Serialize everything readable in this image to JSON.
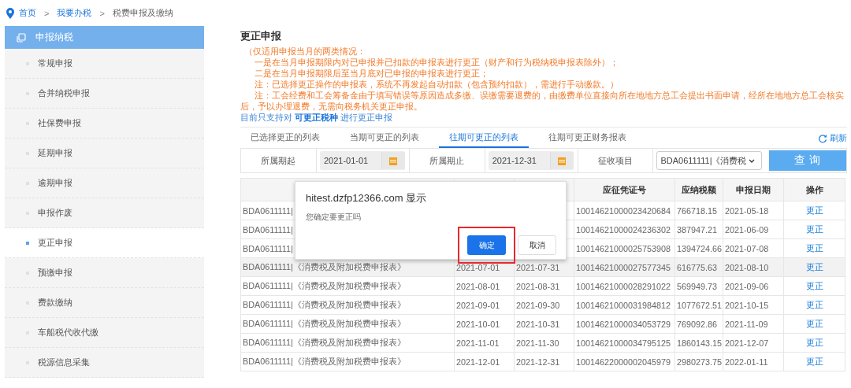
{
  "breadcrumb": {
    "separator": ">",
    "items": [
      {
        "label": "首页",
        "link": true
      },
      {
        "label": "我要办税",
        "link": true
      },
      {
        "label": "税费申报及缴纳",
        "link": false
      }
    ]
  },
  "sidebar": {
    "title": "申报纳税",
    "items": [
      {
        "label": "常规申报",
        "selected": false
      },
      {
        "label": "合并纳税申报",
        "selected": false
      },
      {
        "label": "社保费申报",
        "selected": false
      },
      {
        "label": "延期申报",
        "selected": false
      },
      {
        "label": "逾期申报",
        "selected": false
      },
      {
        "label": "申报作废",
        "selected": false
      },
      {
        "label": "更正申报",
        "selected": true
      },
      {
        "label": "预缴申报",
        "selected": false
      },
      {
        "label": "费款缴纳",
        "selected": false
      },
      {
        "label": "车船税代收代缴",
        "selected": false
      },
      {
        "label": "税源信息采集",
        "selected": false
      }
    ]
  },
  "page_title": "更正申报",
  "notes": [
    {
      "kind": "lead",
      "text": "（仅适用申报当月的两类情况："
    },
    {
      "kind": "indent",
      "text": "一是在当月申报期限内对已申报并已扣款的申报表进行更正（财产和行为税纳税申报表除外）；"
    },
    {
      "kind": "indent",
      "text": "二是在当月申报期限后至当月底对已申报的申报表进行更正；"
    },
    {
      "kind": "indent",
      "text": "注：已选择更正操作的申报表，系统不再发起自动扣款（包含预约扣款），需进行手动缴款。）"
    },
    {
      "kind": "indent",
      "text": "注：工会经费和工会筹备金由于填写错误等原因造成多缴、误缴需要退费的，由缴费单位直接向所在地地方总工会提出书面申请，经所在地地方总工会核实后，予以办理退费，无需向税务机关更正申报。"
    },
    {
      "kind": "info",
      "text": "目前只支持对 **可更正税种** 进行更正申报"
    }
  ],
  "tabs": [
    {
      "label": "已选择更正的列表",
      "selected": false
    },
    {
      "label": "当期可更正的列表",
      "selected": false
    },
    {
      "label": "往期可更正的列表",
      "selected": true
    },
    {
      "label": "往期可更正财务报表",
      "selected": false
    }
  ],
  "refresh": "刷新",
  "filter": {
    "start_label": "所属期起",
    "start_value": "2021-01-01",
    "end_label": "所属期止",
    "end_value": "2021-12-31",
    "item_label": "征收项目",
    "item_value": "BDA0611111|《消费税",
    "query": "查 询"
  },
  "table": {
    "columns": [
      "",
      "",
      "",
      "应征凭证号",
      "应纳税额",
      "申报日期",
      "操作"
    ],
    "rows": [
      {
        "form": "BDA0611111|",
        "voucher": "10014621000023420684",
        "amount": "766718.15",
        "date": "2021-05-18",
        "action": "更正",
        "hover": false
      },
      {
        "form": "BDA0611111|",
        "voucher": "10014621000024236302",
        "amount": "387947.21",
        "date": "2021-06-09",
        "action": "更正",
        "hover": false
      },
      {
        "form": "BDA0611111|",
        "voucher": "10014621000025753908",
        "amount": "1394724.66",
        "date": "2021-07-08",
        "action": "更正",
        "hover": false
      },
      {
        "form": "BDA0611111|《消费税及附加税费申报表》",
        "start": "2021-07-01",
        "end": "2021-07-31",
        "voucher": "10014621000027577345",
        "amount": "616775.63",
        "date": "2021-08-10",
        "action": "更正",
        "hover": true
      },
      {
        "form": "BDA0611111|《消费税及附加税费申报表》",
        "start": "2021-08-01",
        "end": "2021-08-31",
        "voucher": "10014621000028291022",
        "amount": "569949.73",
        "date": "2021-09-06",
        "action": "更正",
        "hover": false
      },
      {
        "form": "BDA0611111|《消费税及附加税费申报表》",
        "start": "2021-09-01",
        "end": "2021-09-30",
        "voucher": "10014621000031984812",
        "amount": "1077672.51",
        "date": "2021-10-15",
        "action": "更正",
        "hover": false
      },
      {
        "form": "BDA0611111|《消费税及附加税费申报表》",
        "start": "2021-10-01",
        "end": "2021-10-31",
        "voucher": "10014621000034053729",
        "amount": "769092.86",
        "date": "2021-11-09",
        "action": "更正",
        "hover": false
      },
      {
        "form": "BDA0611111|《消费税及附加税费申报表》",
        "start": "2021-11-01",
        "end": "2021-11-30",
        "voucher": "10014621000034795125",
        "amount": "1860143.15",
        "date": "2021-12-07",
        "action": "更正",
        "hover": false
      },
      {
        "form": "BDA0611111|《消费税及附加税费申报表》",
        "start": "2021-12-01",
        "end": "2021-12-31",
        "voucher": "10014622000002045979",
        "amount": "2980273.75",
        "date": "2022-01-11",
        "action": "更正",
        "hover": false
      }
    ]
  },
  "dialog": {
    "title": "hitest.dzfp12366.com 显示",
    "message": "您确定要更正吗",
    "confirm": "确定",
    "cancel": "取消",
    "confirm_highlighted": true
  }
}
